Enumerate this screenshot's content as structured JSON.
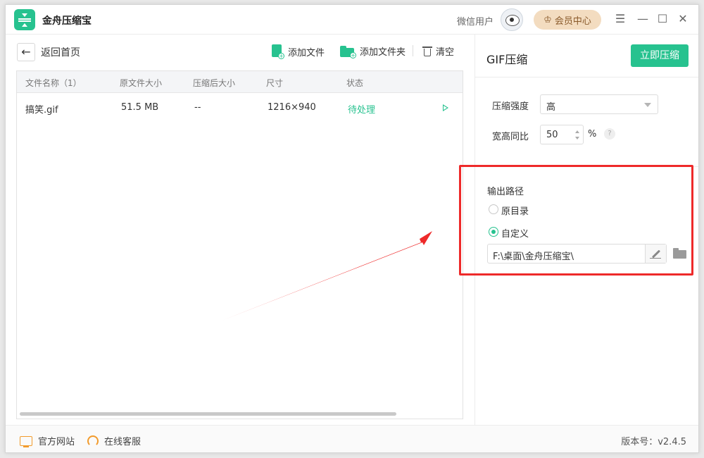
{
  "app": {
    "title": "金舟压缩宝",
    "user_label": "微信用户",
    "vip_label": "会员中心",
    "accent_color": "#27c28f"
  },
  "window_controls": [
    "menu-icon",
    "minimize-icon",
    "maximize-icon",
    "close-icon"
  ],
  "toolbar": {
    "back_label": "返回首页",
    "add_file_label": "添加文件",
    "add_folder_label": "添加文件夹",
    "clear_label": "清空"
  },
  "table": {
    "columns": [
      "文件名称（1）",
      "原文件大小",
      "压缩后大小",
      "尺寸",
      "状态"
    ],
    "rows": [
      {
        "name": "搞笑.gif",
        "original_size": "51.5 MB",
        "compressed_size": "--",
        "dimensions": "1216×940",
        "status": "待处理"
      }
    ]
  },
  "settings": {
    "title": "GIF压缩",
    "compress_button": "立即压缩",
    "strength_label": "压缩强度",
    "strength_value": "高",
    "ratio_label": "宽高同比",
    "ratio_value": "50",
    "ratio_unit": "%",
    "help_glyph": "?",
    "output_label": "输出路径",
    "option_original": "原目录",
    "option_custom": "自定义",
    "selected_option": "自定义",
    "output_path": "F:\\桌面\\金舟压缩宝\\"
  },
  "statusbar": {
    "website_label": "官方网站",
    "support_label": "在线客服",
    "version": "版本号：v2.4.5"
  },
  "annotation_color": "#ee2a2a"
}
